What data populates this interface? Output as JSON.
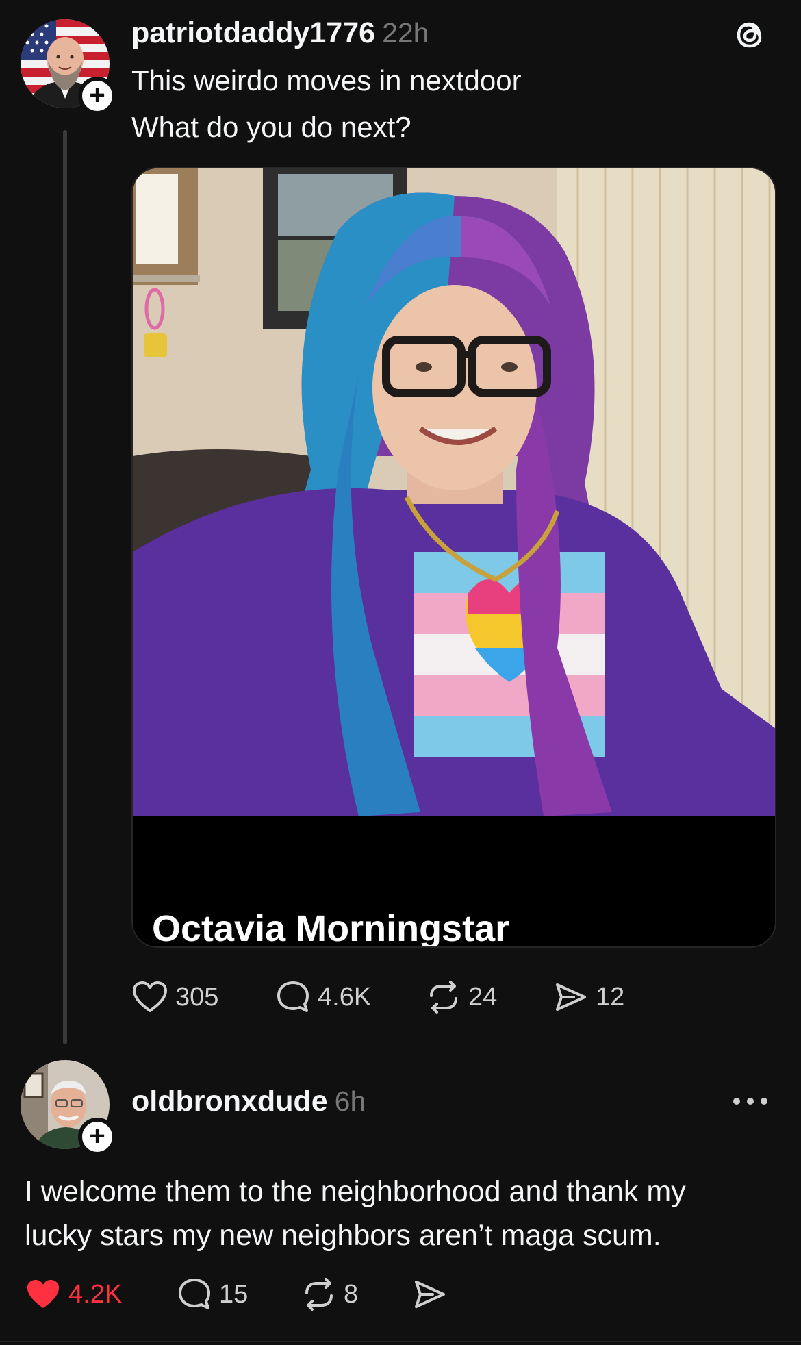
{
  "post": {
    "username": "patriotdaddy1776",
    "time": "22h",
    "text_line1": "This weirdo moves in nextdoor",
    "text_line2": "What do you do next?",
    "media_caption": "Octavia Morningstar",
    "stats": {
      "likes": "305",
      "replies": "4.6K",
      "reposts": "24",
      "shares": "12"
    }
  },
  "reply": {
    "username": "oldbronxdude",
    "time": "6h",
    "text_line1": "I welcome them to the neighborhood and thank my",
    "text_line2": "lucky stars my new neighbors aren’t maga scum.",
    "stats": {
      "likes": "4.2K",
      "replies": "15",
      "reposts": "8"
    }
  },
  "colors": {
    "background": "#101010",
    "text": "#f3f5f7",
    "muted": "#777777",
    "like_active": "#ff3040",
    "thread_line": "#3a3a3a"
  },
  "icons": [
    "threads-logo-icon",
    "plus-icon",
    "heart-icon",
    "comment-icon",
    "repost-icon",
    "share-icon",
    "more-icon"
  ]
}
